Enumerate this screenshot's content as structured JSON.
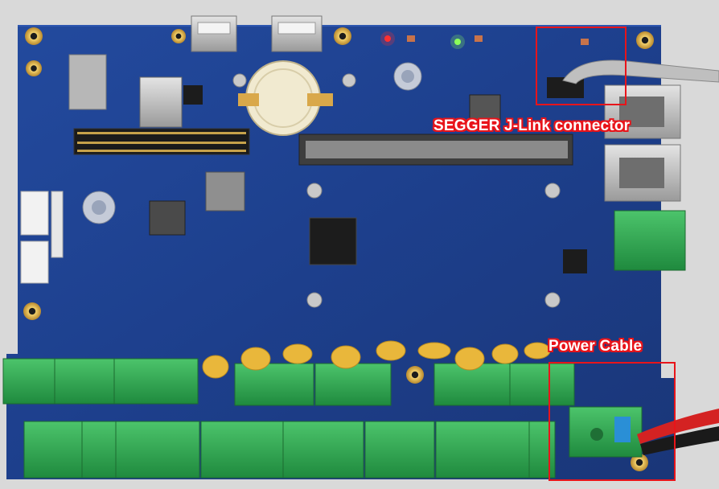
{
  "annotations": {
    "jlink": {
      "label": "SEGGER J-Link connector"
    },
    "power": {
      "label": "Power Cable"
    }
  },
  "colors": {
    "background": "#d9d9d9",
    "pcb": "#1f3f8f",
    "annotation": "#e8141a",
    "terminal": "#2fa84f",
    "capacitor": "#e9b73b"
  }
}
